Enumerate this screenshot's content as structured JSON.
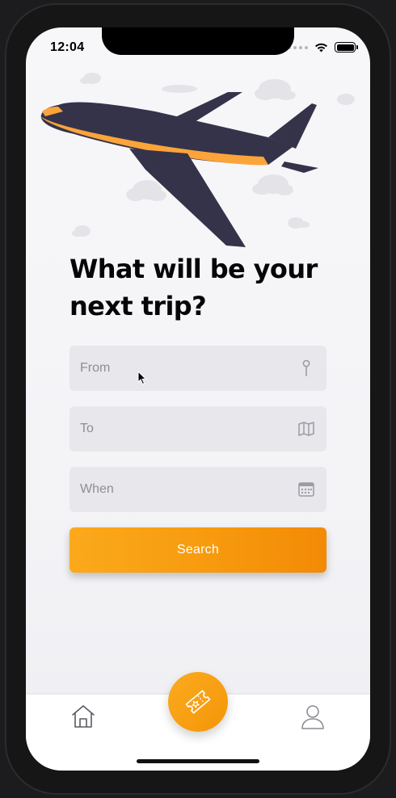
{
  "status_bar": {
    "time": "12:04",
    "icons": [
      "signal-dots-icon",
      "wifi-icon",
      "battery-icon"
    ]
  },
  "hero": {
    "illustration": "airplane-with-clouds",
    "colors": {
      "plane_body": "#35334a",
      "plane_stripe": "#fba43a",
      "clouds": "#e4e4e8"
    }
  },
  "headline": {
    "line1": "What will be your",
    "line2": "next trip?"
  },
  "form": {
    "from": {
      "placeholder": "From",
      "icon": "location-pin-icon"
    },
    "to": {
      "placeholder": "To",
      "icon": "map-icon"
    },
    "when": {
      "placeholder": "When",
      "icon": "calendar-icon"
    },
    "search_label": "Search"
  },
  "tab_bar": {
    "home_icon": "home-icon",
    "center_icon": "ticket-icon",
    "profile_icon": "profile-icon"
  },
  "colors": {
    "accent": "#f79a0e",
    "field_bg": "#e7e7ec",
    "placeholder_text": "#8e8e94",
    "headline_text": "#060609"
  }
}
